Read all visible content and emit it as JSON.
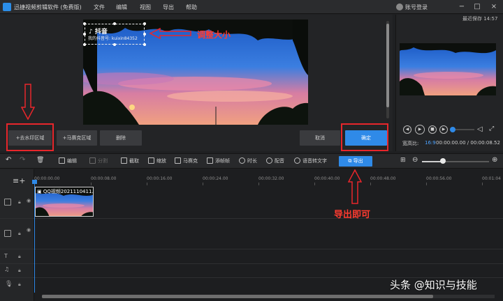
{
  "window": {
    "title": "迅捷视频剪辑软件 (免费版)",
    "menu": [
      "文件",
      "编辑",
      "视图",
      "导出",
      "帮助"
    ],
    "account": "账号登录",
    "minimize": "−",
    "maximize": "□",
    "close": "×",
    "last_save": "最近保存 14:57"
  },
  "watermark_overlay": {
    "logo_text": "♪ 抖音",
    "id_text": "我的抖音号: kuixin84352"
  },
  "annotations": {
    "resize_note": "调整大小",
    "export_note": "导出即可",
    "colors": {
      "red": "#e8262b",
      "accent": "#2f8ae8"
    }
  },
  "editor_buttons": {
    "remove_watermark": "+去水印区域",
    "add_mosaic": "+马赛克区域",
    "delete": "删除",
    "cancel": "取消",
    "confirm": "确定"
  },
  "preview": {
    "ratio_label": "宽高比:",
    "ratio_value": "16:9",
    "time": "00:00:00.00 / 00:00:08.52"
  },
  "toolbar": {
    "undo": "↶",
    "redo": "↷",
    "trash": "🗑",
    "tools": [
      {
        "label": "编辑"
      },
      {
        "label": "分割"
      },
      {
        "label": "截取"
      },
      {
        "label": "缩放"
      },
      {
        "label": "马赛克"
      },
      {
        "label": "添帧帧"
      },
      {
        "label": "时长"
      },
      {
        "label": "配音"
      },
      {
        "label": "语音转文字"
      }
    ],
    "export": "导出"
  },
  "timeline": {
    "ruler": [
      "00:00:00.00",
      "00:00:08.00",
      "00:00:16.00",
      "00:00:24.00",
      "00:00:32.00",
      "00:00:40.00",
      "00:00:48.00",
      "00:00:56.00",
      "00:01:04"
    ],
    "clip_label": "QQ视频2021110411...",
    "track_icons": [
      "T",
      "♫"
    ]
  },
  "credit": "头条 @知识与技能"
}
